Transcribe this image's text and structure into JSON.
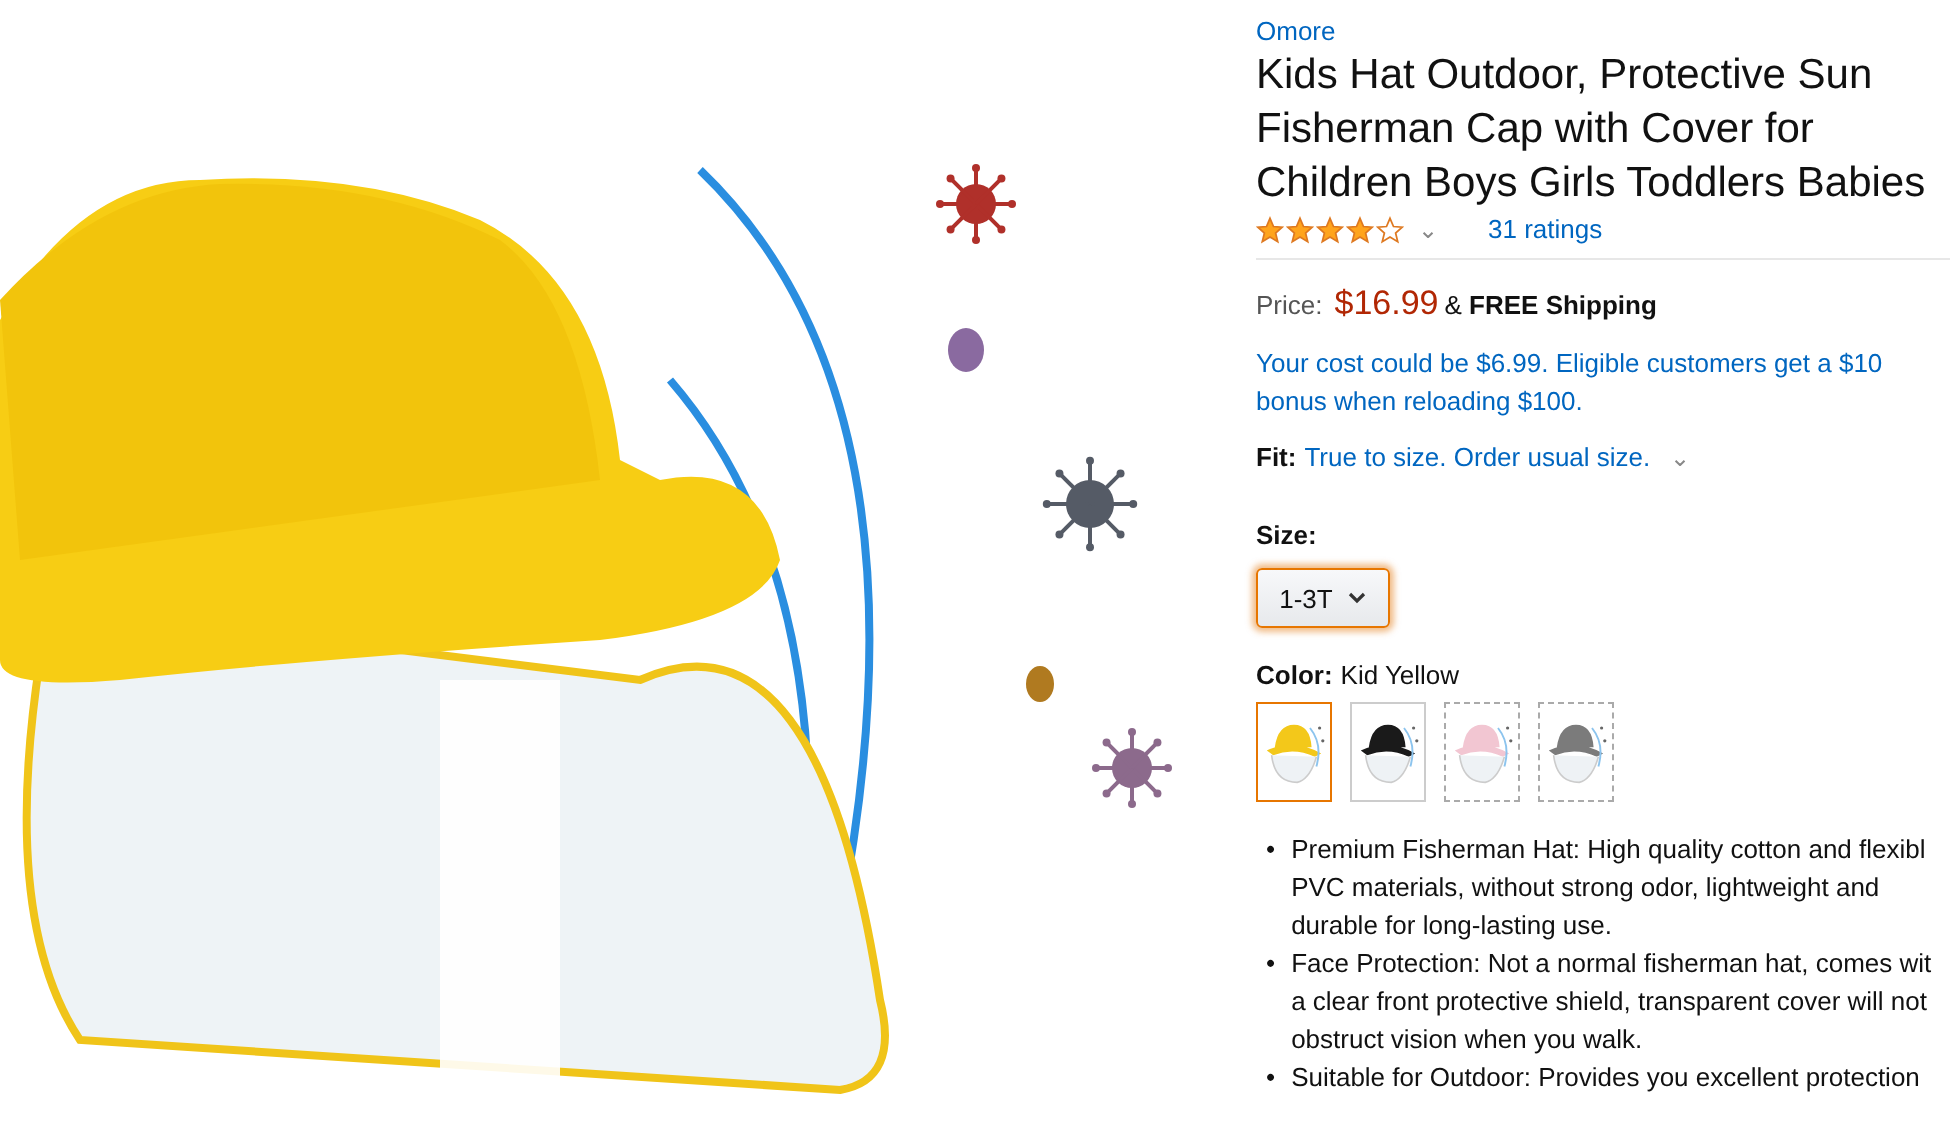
{
  "brand": "Omore",
  "title_lines": [
    "Kids Hat Outdoor, Protective Sun",
    "Fisherman Cap with Cover for",
    "Children Boys Girls Toddlers Babies"
  ],
  "rating": {
    "stars": 4,
    "caret": "⌄",
    "count": "31 ratings"
  },
  "price": {
    "label": "Price:",
    "amount": "$16.99",
    "shipping_prefix": "&",
    "shipping": "FREE Shipping"
  },
  "promo_lines": [
    "Your cost could be $6.99. Eligible customers get a $10",
    "bonus when reloading $100."
  ],
  "fit": {
    "label": "Fit:",
    "value": "True to size. Order usual size.",
    "caret": "⌄"
  },
  "size": {
    "label": "Size:",
    "value": "1-3T"
  },
  "color": {
    "label": "Color:",
    "value": "Kid Yellow"
  },
  "swatches": [
    {
      "color": "#f3c81a",
      "selected": true,
      "available": true
    },
    {
      "color": "#1a1a1a",
      "selected": false,
      "available": true
    },
    {
      "color": "#f2c6d2",
      "selected": false,
      "available": false
    },
    {
      "color": "#7b7b7b",
      "selected": false,
      "available": false
    }
  ],
  "bullets": [
    {
      "marker": "•",
      "lines": [
        "Premium Fisherman Hat: High quality cotton and flexibl",
        "PVC materials, without strong odor, lightweight and",
        "durable for long-lasting use."
      ]
    },
    {
      "marker": "•",
      "lines": [
        "Face Protection: Not a normal fisherman hat, comes wit",
        "a clear front protective shield, transparent cover will not",
        "obstruct vision when you walk."
      ]
    },
    {
      "marker": "•",
      "lines": [
        "Suitable for Outdoor: Provides you excellent protection"
      ]
    }
  ]
}
